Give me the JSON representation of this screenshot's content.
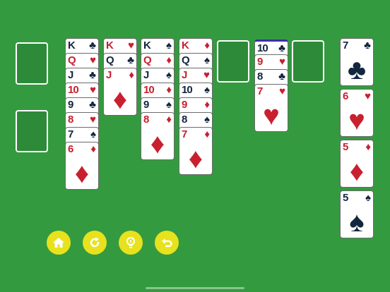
{
  "colors": {
    "felt": "#349a3f",
    "button": "#e7e21d",
    "red_suit": "#c8202f",
    "black_suit": "#13263f"
  },
  "tableau": [
    {
      "name": "pile-1",
      "cards": [
        {
          "rank": "K",
          "suit": "♣"
        },
        {
          "rank": "Q",
          "suit": "♥"
        },
        {
          "rank": "J",
          "suit": "♣"
        },
        {
          "rank": "10",
          "suit": "♥"
        },
        {
          "rank": "9",
          "suit": "♣"
        },
        {
          "rank": "8",
          "suit": "♥"
        },
        {
          "rank": "7",
          "suit": "♠"
        },
        {
          "rank": "6",
          "suit": "♦"
        }
      ]
    },
    {
      "name": "pile-2",
      "cards": [
        {
          "rank": "K",
          "suit": "♥"
        },
        {
          "rank": "Q",
          "suit": "♣"
        },
        {
          "rank": "J",
          "suit": "♦"
        }
      ]
    },
    {
      "name": "pile-3",
      "cards": [
        {
          "rank": "K",
          "suit": "♠"
        },
        {
          "rank": "Q",
          "suit": "♦"
        },
        {
          "rank": "J",
          "suit": "♠"
        },
        {
          "rank": "10",
          "suit": "♦"
        },
        {
          "rank": "9",
          "suit": "♠"
        },
        {
          "rank": "8",
          "suit": "♦"
        }
      ]
    },
    {
      "name": "pile-4",
      "cards": [
        {
          "rank": "K",
          "suit": "♦"
        },
        {
          "rank": "Q",
          "suit": "♠"
        },
        {
          "rank": "J",
          "suit": "♥"
        },
        {
          "rank": "10",
          "suit": "♠"
        },
        {
          "rank": "9",
          "suit": "♦"
        },
        {
          "rank": "8",
          "suit": "♠"
        },
        {
          "rank": "7",
          "suit": "♦"
        }
      ]
    },
    {
      "name": "pile-6",
      "cards": [
        {
          "rank": "10",
          "suit": "♣"
        },
        {
          "rank": "9",
          "suit": "♥"
        },
        {
          "rank": "8",
          "suit": "♣"
        },
        {
          "rank": "7",
          "suit": "♥"
        }
      ]
    }
  ],
  "foundations": [
    {
      "rank": "7",
      "suit": "♣"
    },
    {
      "rank": "6",
      "suit": "♥"
    },
    {
      "rank": "5",
      "suit": "♦"
    },
    {
      "rank": "5",
      "suit": "♠"
    }
  ],
  "buttons": [
    {
      "name": "home-button",
      "icon": "home-icon"
    },
    {
      "name": "restart-button",
      "icon": "restart-icon"
    },
    {
      "name": "hint-button",
      "icon": "lightbulb-icon"
    },
    {
      "name": "undo-button",
      "icon": "undo-icon"
    }
  ]
}
